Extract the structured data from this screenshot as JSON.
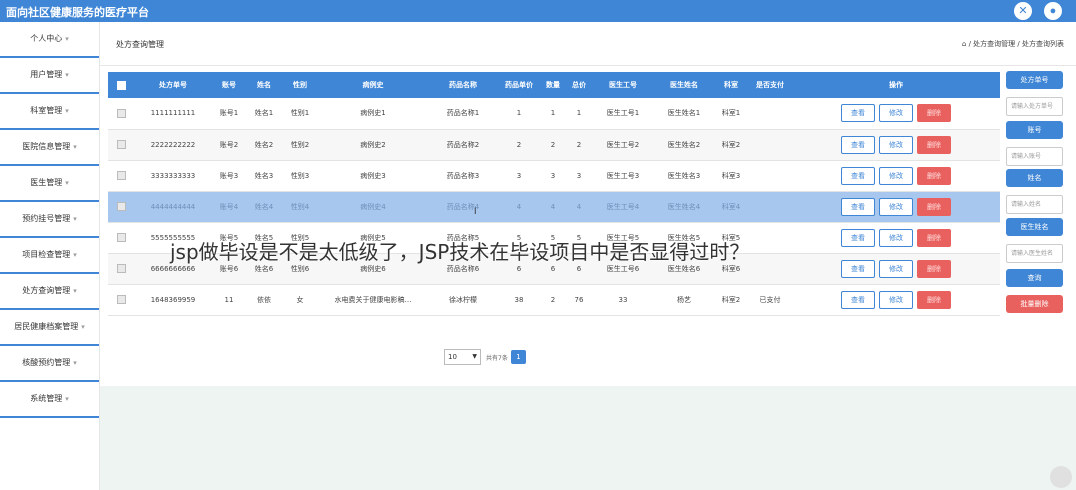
{
  "app": {
    "title": "面向社区健康服务的医疗平台"
  },
  "topbar": {
    "settings_icon": "tools-icon",
    "user_icon": "user-icon"
  },
  "sidebar": {
    "items": [
      {
        "label": "个人中心"
      },
      {
        "label": "用户管理"
      },
      {
        "label": "科室管理"
      },
      {
        "label": "医院信息管理"
      },
      {
        "label": "医生管理"
      },
      {
        "label": "预约挂号管理"
      },
      {
        "label": "项目检查管理"
      },
      {
        "label": "处方查询管理"
      },
      {
        "label": "居民健康档案管理"
      },
      {
        "label": "核酸预约管理"
      },
      {
        "label": "系统管理"
      }
    ]
  },
  "page": {
    "title": "处方查询管理",
    "breadcrumb": "/ 处方查询管理 / 处方查询列表"
  },
  "table": {
    "headers": [
      "处方单号",
      "账号",
      "姓名",
      "性别",
      "病例史",
      "药品名称",
      "药品单价",
      "数量",
      "总价",
      "医生工号",
      "医生姓名",
      "科室",
      "是否支付",
      "操作"
    ],
    "rows": [
      {
        "cells": [
          "1111111111",
          "账号1",
          "姓名1",
          "性别1",
          "病例史1",
          "药品名称1",
          "1",
          "1",
          "1",
          "医生工号1",
          "医生姓名1",
          "科室1",
          ""
        ]
      },
      {
        "cells": [
          "2222222222",
          "账号2",
          "姓名2",
          "性别2",
          "病例史2",
          "药品名称2",
          "2",
          "2",
          "2",
          "医生工号2",
          "医生姓名2",
          "科室2",
          ""
        ]
      },
      {
        "cells": [
          "3333333333",
          "账号3",
          "姓名3",
          "性别3",
          "病例史3",
          "药品名称3",
          "3",
          "3",
          "3",
          "医生工号3",
          "医生姓名3",
          "科室3",
          ""
        ]
      },
      {
        "cells": [
          "4444444444",
          "账号4",
          "姓名4",
          "性别4",
          "病例史4",
          "药品名称4",
          "4",
          "4",
          "4",
          "医生工号4",
          "医生姓名4",
          "科室4",
          ""
        ]
      },
      {
        "cells": [
          "5555555555",
          "账号5",
          "姓名5",
          "性别5",
          "病例史5",
          "药品名称5",
          "5",
          "5",
          "5",
          "医生工号5",
          "医生姓名5",
          "科室5",
          ""
        ]
      },
      {
        "cells": [
          "6666666666",
          "账号6",
          "姓名6",
          "性别6",
          "病例史6",
          "药品名称6",
          "6",
          "6",
          "6",
          "医生工号6",
          "医生姓名6",
          "科室6",
          ""
        ]
      },
      {
        "cells": [
          "1648369959",
          "11",
          "依依",
          "女",
          "水电费关于健康电影稿…",
          "徐冰柠檬",
          "38",
          "2",
          "76",
          "33",
          "杨艺",
          "科室2",
          "已支付"
        ]
      }
    ],
    "actions": {
      "view": "查看",
      "edit": "修改",
      "delete": "删除"
    }
  },
  "pager": {
    "page_size": "10",
    "total": "共有7条",
    "current": "1"
  },
  "search_panel": {
    "fields": [
      {
        "button": "处方单号",
        "placeholder": "请输入处方单号"
      },
      {
        "button": "账号",
        "placeholder": "请输入账号"
      },
      {
        "button": "姓名",
        "placeholder": "请输入姓名"
      },
      {
        "button": "医生姓名",
        "placeholder": "请输入医生姓名"
      }
    ],
    "query_label": "查询",
    "batch_delete_label": "批量删除"
  },
  "overlay_caption": "jsp做毕设是不是太低级了，JSP技术在毕设项目中是否显得过时？",
  "colors": {
    "primary": "#3f86d6",
    "danger": "#e9615e",
    "selected_row": "#a7c7ef"
  }
}
